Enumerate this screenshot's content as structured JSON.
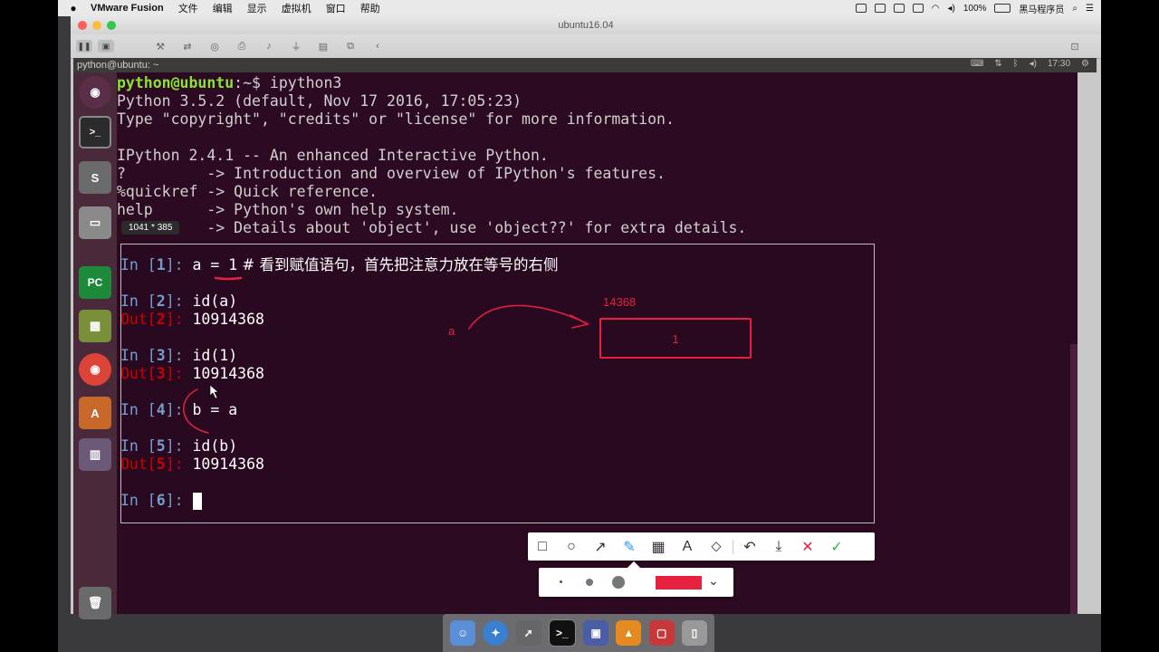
{
  "mac_menubar": {
    "apple": "",
    "app_name": "VMware Fusion",
    "menus": [
      "文件",
      "编辑",
      "显示",
      "虚拟机",
      "窗口",
      "帮助"
    ],
    "battery": "100%",
    "user": "黑马程序员"
  },
  "vmware": {
    "window_title": "ubuntu16.04"
  },
  "ubuntu": {
    "window_title": "python@ubuntu: ~",
    "clock": "17:30"
  },
  "terminal": {
    "prompt_user": "python@ubuntu",
    "prompt_path": ":~$ ",
    "command": "ipython3",
    "lines": [
      "Python 3.5.2 (default, Nov 17 2016, 17:05:23)",
      "Type \"copyright\", \"credits\" or \"license\" for more information.",
      "",
      "IPython 2.4.1 -- An enhanced Interactive Python.",
      "?         -> Introduction and overview of IPython's features.",
      "%quickref -> Quick reference.",
      "help      -> Python's own help system.",
      "          -> Details about 'object', use 'object??' for extra details."
    ]
  },
  "annotation": {
    "size_label": "1041 * 385",
    "cells": [
      {
        "in_label": "In [",
        "num": "1",
        "close": "]: ",
        "code": "a = 1",
        "comment": " # 看到赋值语句，首先把注意力放在等号的右侧"
      },
      {
        "in_label": "In [",
        "num": "2",
        "close": "]: ",
        "code": "id(a)",
        "out_label": "Out[",
        "out_num": "2",
        "out_close": "]: ",
        "out": "10914368"
      },
      {
        "in_label": "In [",
        "num": "3",
        "close": "]: ",
        "code": "id(1)",
        "out_label": "Out[",
        "out_num": "3",
        "out_close": "]: ",
        "out": "10914368"
      },
      {
        "in_label": "In [",
        "num": "4",
        "close": "]: ",
        "code": "b = a"
      },
      {
        "in_label": "In [",
        "num": "5",
        "close": "]: ",
        "code": "id(b)",
        "out_label": "Out[",
        "out_num": "5",
        "out_close": "]: ",
        "out": "10914368"
      },
      {
        "in_label": "In [",
        "num": "6",
        "close": "]: ",
        "code": ""
      }
    ],
    "drawing": {
      "address_label": "14368",
      "var_label": "a",
      "box_value": "1",
      "color": "#e8203f"
    },
    "tools": [
      "rectangle-icon",
      "circle-icon",
      "arrow-icon",
      "pen-icon",
      "mosaic-icon",
      "text-icon",
      "tag-icon",
      "undo-icon",
      "download-icon",
      "close-icon",
      "confirm-icon"
    ],
    "selected_color": "#e8203f"
  }
}
